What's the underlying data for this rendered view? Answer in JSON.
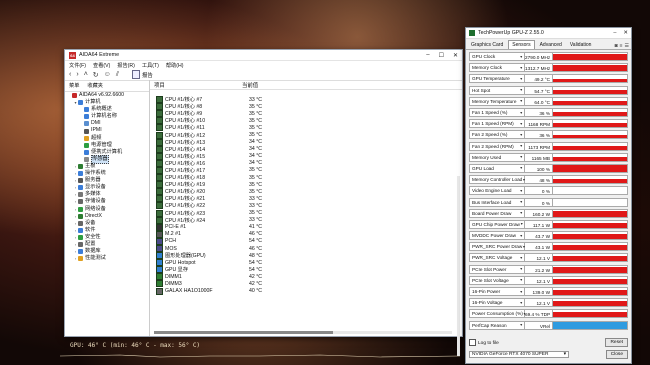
{
  "desktop": {
    "overlay_text": "GPU: 46° C  (min: 46° C - max: 56° C)"
  },
  "aida": {
    "title": "AIDA64 Extreme",
    "app_icon": "64",
    "menu": [
      "文件(F)",
      "查看(V)",
      "报告(R)",
      "工具(T)",
      "帮助(H)"
    ],
    "toolbar": {
      "report_label": "报告"
    },
    "left_tabs": [
      "菜单",
      "收藏夹"
    ],
    "tree": [
      {
        "label": "AIDA64 v6.92.6600",
        "indent": 0,
        "icon": "#c62828",
        "tw": ""
      },
      {
        "label": "计算机",
        "indent": 1,
        "icon": "#3b7dd8",
        "tw": "v"
      },
      {
        "label": "系统概述",
        "indent": 2,
        "icon": "#3b7dd8",
        "tw": ""
      },
      {
        "label": "计算机名称",
        "indent": 2,
        "icon": "#3b7dd8",
        "tw": ""
      },
      {
        "label": "DMI",
        "indent": 2,
        "icon": "#5a8fd0",
        "tw": ""
      },
      {
        "label": "IPMI",
        "indent": 2,
        "icon": "#555",
        "tw": ""
      },
      {
        "label": "超频",
        "indent": 2,
        "icon": "#e0a020",
        "tw": ""
      },
      {
        "label": "电源管理",
        "indent": 2,
        "icon": "#2e9e40",
        "tw": ""
      },
      {
        "label": "便携式计算机",
        "indent": 2,
        "icon": "#3b7dd8",
        "tw": ""
      },
      {
        "label": "传感器",
        "indent": 2,
        "icon": "#888",
        "tw": "",
        "selected": true
      },
      {
        "label": "主板",
        "indent": 1,
        "icon": "#2e7d32",
        "tw": ">"
      },
      {
        "label": "操作系统",
        "indent": 1,
        "icon": "#3b7dd8",
        "tw": ">"
      },
      {
        "label": "服务器",
        "indent": 1,
        "icon": "#555",
        "tw": ">"
      },
      {
        "label": "显示设备",
        "indent": 1,
        "icon": "#3b7dd8",
        "tw": ">"
      },
      {
        "label": "多媒体",
        "indent": 1,
        "icon": "#777",
        "tw": ">"
      },
      {
        "label": "存储设备",
        "indent": 1,
        "icon": "#666",
        "tw": ">"
      },
      {
        "label": "网络设备",
        "indent": 1,
        "icon": "#2e9e40",
        "tw": ">"
      },
      {
        "label": "DirectX",
        "indent": 1,
        "icon": "#2e7d32",
        "tw": ">"
      },
      {
        "label": "设备",
        "indent": 1,
        "icon": "#666",
        "tw": ">"
      },
      {
        "label": "软件",
        "indent": 1,
        "icon": "#3b7dd8",
        "tw": ">"
      },
      {
        "label": "安全性",
        "indent": 1,
        "icon": "#2e9e40",
        "tw": ">"
      },
      {
        "label": "配置",
        "indent": 1,
        "icon": "#666",
        "tw": ">"
      },
      {
        "label": "数据库",
        "indent": 1,
        "icon": "#3b7dd8",
        "tw": ">"
      },
      {
        "label": "性能测试",
        "indent": 1,
        "icon": "#e0a020",
        "tw": ">"
      }
    ],
    "columns": [
      "项目",
      "当前值"
    ],
    "rows": [
      {
        "name": "CPU #1/核心 #7",
        "value": "33 °C",
        "icon": "#3a6b3a"
      },
      {
        "name": "CPU #1/核心 #8",
        "value": "35 °C",
        "icon": "#3a6b3a"
      },
      {
        "name": "CPU #1/核心 #9",
        "value": "35 °C",
        "icon": "#3a6b3a"
      },
      {
        "name": "CPU #1/核心 #10",
        "value": "35 °C",
        "icon": "#3a6b3a"
      },
      {
        "name": "CPU #1/核心 #11",
        "value": "35 °C",
        "icon": "#3a6b3a"
      },
      {
        "name": "CPU #1/核心 #12",
        "value": "35 °C",
        "icon": "#3a6b3a"
      },
      {
        "name": "CPU #1/核心 #13",
        "value": "34 °C",
        "icon": "#3a6b3a"
      },
      {
        "name": "CPU #1/核心 #14",
        "value": "34 °C",
        "icon": "#3a6b3a"
      },
      {
        "name": "CPU #1/核心 #15",
        "value": "34 °C",
        "icon": "#3a6b3a"
      },
      {
        "name": "CPU #1/核心 #16",
        "value": "34 °C",
        "icon": "#3a6b3a"
      },
      {
        "name": "CPU #1/核心 #17",
        "value": "35 °C",
        "icon": "#3a6b3a"
      },
      {
        "name": "CPU #1/核心 #18",
        "value": "35 °C",
        "icon": "#3a6b3a"
      },
      {
        "name": "CPU #1/核心 #19",
        "value": "35 °C",
        "icon": "#3a6b3a"
      },
      {
        "name": "CPU #1/核心 #20",
        "value": "35 °C",
        "icon": "#3a6b3a"
      },
      {
        "name": "CPU #1/核心 #21",
        "value": "33 °C",
        "icon": "#3a6b3a"
      },
      {
        "name": "CPU #1/核心 #22",
        "value": "33 °C",
        "icon": "#3a6b3a"
      },
      {
        "name": "CPU #1/核心 #23",
        "value": "35 °C",
        "icon": "#3a6b3a"
      },
      {
        "name": "CPU #1/核心 #24",
        "value": "33 °C",
        "icon": "#3a6b3a"
      },
      {
        "name": "PCI-E #1",
        "value": "41 °C",
        "icon": "#333"
      },
      {
        "name": "M.2 #1",
        "value": "46 °C",
        "icon": "#555"
      },
      {
        "name": "PCH",
        "value": "54 °C",
        "icon": "#4a4a8a"
      },
      {
        "name": "MOS",
        "value": "46 °C",
        "icon": "#4a4a8a"
      },
      {
        "name": "图形处理器(GPU)",
        "value": "48 °C",
        "icon": "#2f7fd0"
      },
      {
        "name": "GPU Hotspot",
        "value": "54 °C",
        "icon": "#2f7fd0"
      },
      {
        "name": "GPU 显存",
        "value": "54 °C",
        "icon": "#2f7fd0"
      },
      {
        "name": "DIMM1",
        "value": "42 °C",
        "icon": "#2e7d32"
      },
      {
        "name": "DIMM3",
        "value": "42 °C",
        "icon": "#2e7d32"
      },
      {
        "name": "GALAX HA1O1000F",
        "value": "40 °C",
        "icon": "#666"
      }
    ]
  },
  "gpuz": {
    "title": "TechPowerUp GPU-Z 2.55.0",
    "tabs": [
      "Graphics Card",
      "Sensors",
      "Advanced",
      "Validation"
    ],
    "active_tab": "Sensors",
    "sensors": [
      {
        "name": "GPU Clock",
        "value": "2790.0 MHz",
        "level": 0.9
      },
      {
        "name": "Memory Clock",
        "value": "1312.7 MHz",
        "level": 0.9
      },
      {
        "name": "GPU Temperature",
        "value": "49.2 °C",
        "level": 0.45
      },
      {
        "name": "Hot Spot",
        "value": "54.7 °C",
        "level": 0.5
      },
      {
        "name": "Memory Temperature",
        "value": "64.0 °C",
        "level": 0.6
      },
      {
        "name": "Fan 1 Speed (%)",
        "value": "36 %",
        "level": 0.55
      },
      {
        "name": "Fan 1 Speed (RPM)",
        "value": "1168 RPM",
        "level": 0.55
      },
      {
        "name": "Fan 2 Speed (%)",
        "value": "36 %",
        "level": 0.55
      },
      {
        "name": "Fan 2 Speed (RPM)",
        "value": "1173 RPM",
        "level": 0.55
      },
      {
        "name": "Memory Used",
        "value": "1165 MB",
        "level": 0.6
      },
      {
        "name": "GPU Load",
        "value": "100 %",
        "level": 1.0
      },
      {
        "name": "Memory Controller Load",
        "value": "48 %",
        "level": 0.6
      },
      {
        "name": "Video Engine Load",
        "value": "0 %",
        "level": 0.0
      },
      {
        "name": "Bus Interface Load",
        "value": "0 %",
        "level": 0.0
      },
      {
        "name": "Board Power Draw",
        "value": "160.2 W",
        "level": 0.75
      },
      {
        "name": "GPU Chip Power Draw",
        "value": "117.1 W",
        "level": 0.75
      },
      {
        "name": "MVDDC Power Draw",
        "value": "43.7 W",
        "level": 0.75
      },
      {
        "name": "PWR_SRC Power Draw",
        "value": "43.1 W",
        "level": 0.75
      },
      {
        "name": "PWR_SRC Voltage",
        "value": "12.1 V",
        "level": 0.75
      },
      {
        "name": "PCIe Slot Power",
        "value": "21.2 W",
        "level": 0.75
      },
      {
        "name": "PCIe Slot Voltage",
        "value": "12.1 V",
        "level": 0.75
      },
      {
        "name": "16-Pin Power",
        "value": "139.0 W",
        "level": 0.75
      },
      {
        "name": "16-Pin Voltage",
        "value": "12.1 V",
        "level": 0.75
      },
      {
        "name": "Power Consumption (%)",
        "value": "69.4 % TDP",
        "level": 0.75
      },
      {
        "name": "PerfCap Reason",
        "value": "VRel",
        "level": 1.0,
        "color": "#2f9be0"
      }
    ],
    "log_label": "Log to file",
    "reset_label": "Reset",
    "gpu_select": "NVIDIA GeForce RTX 4070 SUPER",
    "close_label": "Close"
  }
}
